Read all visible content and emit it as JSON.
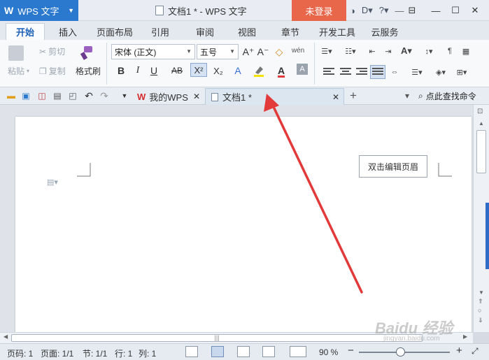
{
  "titlebar": {
    "app_logo": "W",
    "app_name": "WPS 文字",
    "document_title": "文档1 * - WPS 文字",
    "login_label": "未登录"
  },
  "ribbon_tabs": [
    "开始",
    "插入",
    "页面布局",
    "引用",
    "审阅",
    "视图",
    "章节",
    "开发工具",
    "云服务"
  ],
  "ribbon": {
    "paste_label": "粘贴",
    "cut_label": "剪切",
    "copy_label": "复制",
    "format_painter_label": "格式刷",
    "font_name": "宋体 (正文)",
    "font_size": "五号",
    "phonetic_label": "wén",
    "bold": "B",
    "italic": "I",
    "underline": "U",
    "strikethrough": "AB",
    "superscript": "X²",
    "subscript": "X₂",
    "grow_font": "A⁺",
    "shrink_font": "A⁻",
    "font_color": "A",
    "text_effect": "A"
  },
  "quickbar": {
    "doc_tabs": [
      {
        "label": "我的WPS",
        "active": false
      },
      {
        "label": "文档1 *",
        "active": true
      }
    ],
    "search_label": "点此查找命令"
  },
  "document": {
    "header_tip": "双击编辑页眉"
  },
  "statusbar": {
    "page_number": "页码: 1",
    "pages": "页面: 1/1",
    "section": "节: 1/1",
    "row": "行: 1",
    "column": "列: 1",
    "zoom": "90 %"
  },
  "colors": {
    "accent": "#2b79cf",
    "login": "#e8674a",
    "arrow": "#e23a3a"
  },
  "watermark": {
    "text": "Baidu 经验",
    "sub": "jingyan.baidu.com"
  }
}
